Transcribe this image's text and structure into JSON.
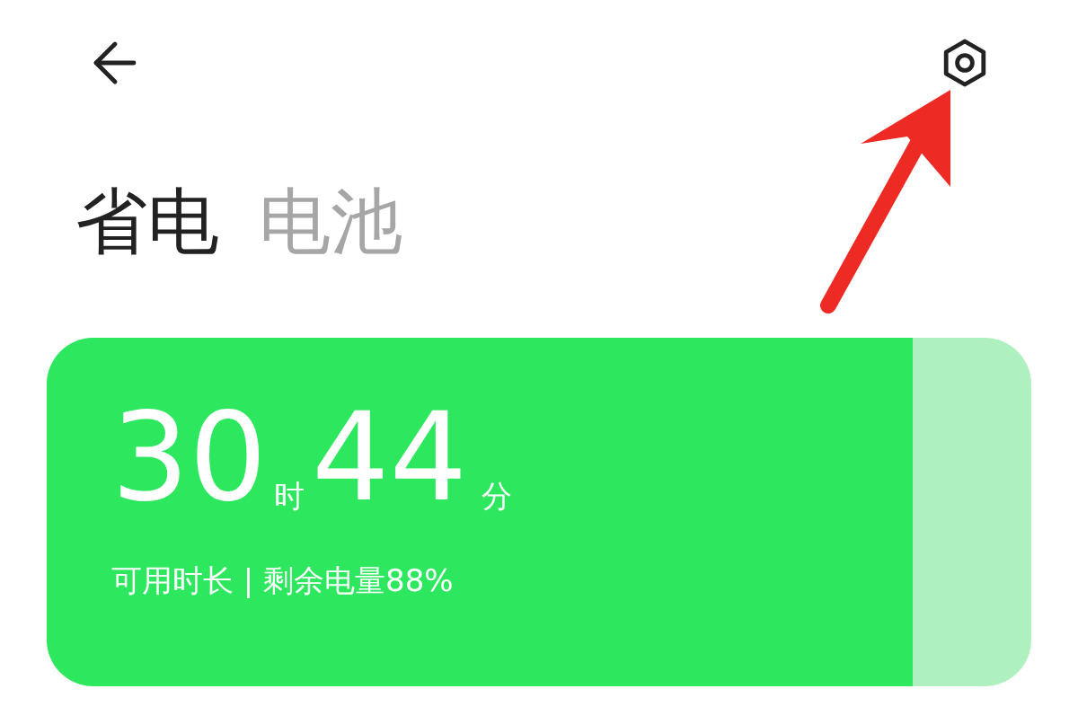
{
  "tabs": [
    {
      "label": "省电",
      "selected": true
    },
    {
      "label": "电池",
      "selected": false
    }
  ],
  "battery": {
    "level": 0.88,
    "hours": "30",
    "hours_unit": "时",
    "minutes": "44",
    "minutes_unit": "分",
    "caption": "可用时长 | 剩余电量88%"
  }
}
